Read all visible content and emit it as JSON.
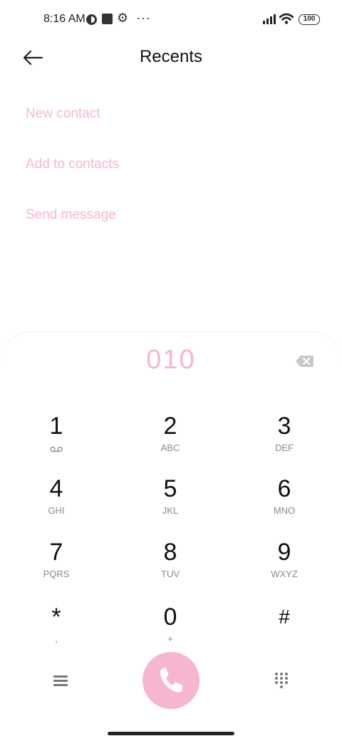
{
  "status_bar": {
    "time": "8:16 AM",
    "more": "···",
    "battery": "100",
    "icons": [
      "dnd-icon",
      "square-notification-icon",
      "gear-icon",
      "more-icon",
      "signal-icon",
      "wifi-icon",
      "battery-icon"
    ]
  },
  "header": {
    "title": "Recents",
    "back_icon": "arrow-left-icon"
  },
  "actions": [
    {
      "label": "New contact"
    },
    {
      "label": "Add to contacts"
    },
    {
      "label": "Send message"
    }
  ],
  "dialer": {
    "number": "010",
    "backspace_icon": "backspace-icon",
    "keys": [
      {
        "digit": "1",
        "letters": "",
        "icon": "voicemail-icon"
      },
      {
        "digit": "2",
        "letters": "ABC"
      },
      {
        "digit": "3",
        "letters": "DEF"
      },
      {
        "digit": "4",
        "letters": "GHI"
      },
      {
        "digit": "5",
        "letters": "JKL"
      },
      {
        "digit": "6",
        "letters": "MNO"
      },
      {
        "digit": "7",
        "letters": "PQRS"
      },
      {
        "digit": "8",
        "letters": "TUV"
      },
      {
        "digit": "9",
        "letters": "WXYZ"
      },
      {
        "digit": "*",
        "letters": ","
      },
      {
        "digit": "0",
        "letters": "+"
      },
      {
        "digit": "#",
        "letters": ""
      }
    ],
    "bottom": {
      "menu_icon": "menu-icon",
      "call_icon": "phone-icon",
      "dialpad_icon": "dialpad-icon"
    }
  },
  "colors": {
    "accent": "#f7b6cf",
    "text": "#111111",
    "secondary_text": "#8a8a8a"
  }
}
